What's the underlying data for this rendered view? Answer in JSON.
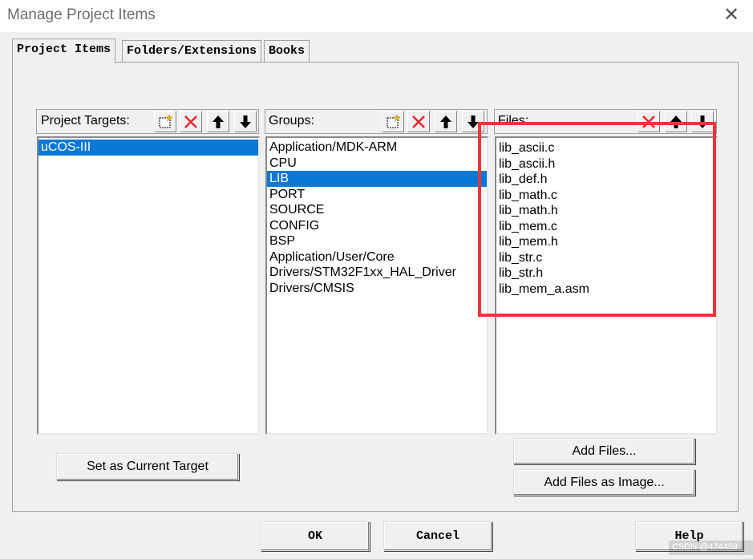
{
  "window": {
    "title": "Manage Project Items"
  },
  "tabs": [
    {
      "label": "Project Items",
      "active": true
    },
    {
      "label": "Folders/Extensions",
      "active": false
    },
    {
      "label": "Books",
      "active": false
    }
  ],
  "targets": {
    "header": "Project Targets:",
    "items": [
      "uCOS-III"
    ],
    "selected_index": 0
  },
  "groups": {
    "header": "Groups:",
    "items": [
      "Application/MDK-ARM",
      "CPU",
      "LIB",
      "PORT",
      "SOURCE",
      "CONFIG",
      "BSP",
      "Application/User/Core",
      "Drivers/STM32F1xx_HAL_Driver",
      "Drivers/CMSIS"
    ],
    "selected_index": 2
  },
  "files": {
    "header": "Files:",
    "items": [
      "lib_ascii.c",
      "lib_ascii.h",
      "lib_def.h",
      "lib_math.c",
      "lib_math.h",
      "lib_mem.c",
      "lib_mem.h",
      "lib_str.c",
      "lib_str.h",
      "lib_mem_a.asm"
    ]
  },
  "buttons": {
    "set_current_target": "Set as Current Target",
    "add_files": "Add Files...",
    "add_files_image": "Add Files as Image...",
    "ok": "OK",
    "cancel": "Cancel",
    "help": "Help"
  },
  "watermark": "CSDN @474459",
  "colors": {
    "selection": "#0a78d7",
    "highlight_box": "#e8363c",
    "delete_icon": "#e8262d"
  }
}
